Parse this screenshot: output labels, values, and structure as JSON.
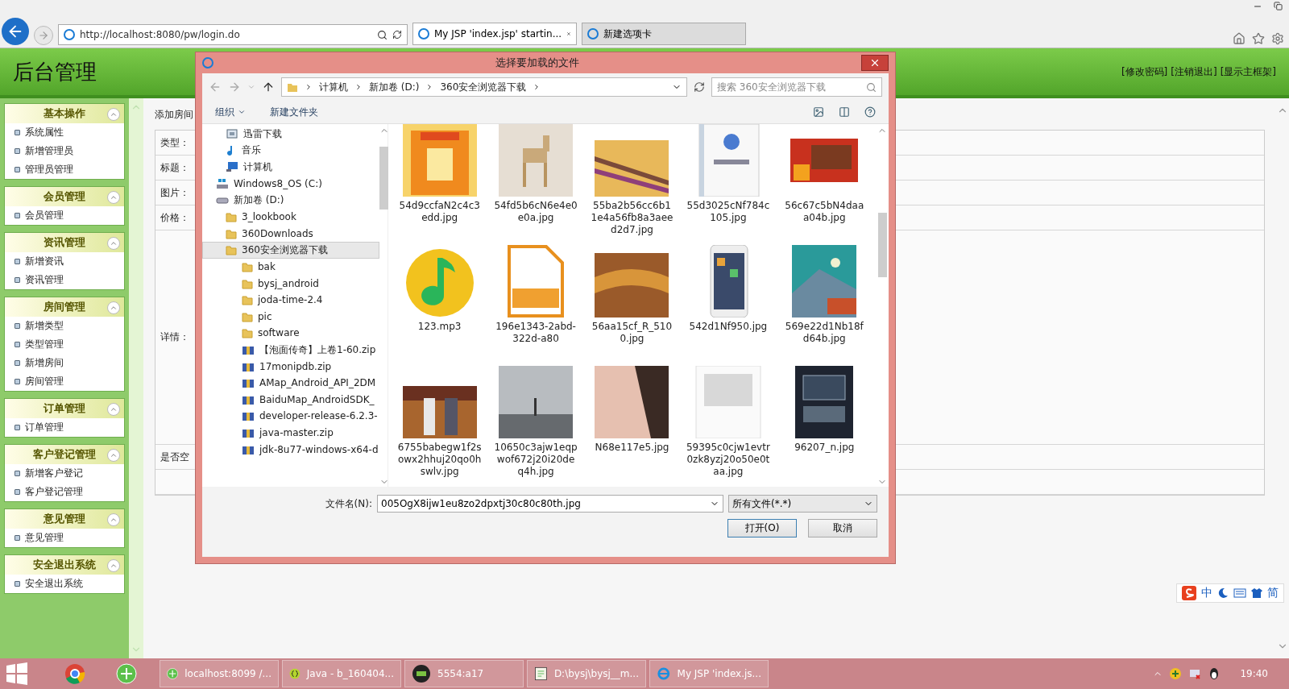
{
  "browser": {
    "address": "http://localhost:8080/pw/login.do",
    "tabs": [
      {
        "label": "My JSP 'index.jsp' startin...",
        "selected": true
      },
      {
        "label": "新建选项卡",
        "selected": false
      }
    ]
  },
  "header": {
    "title": "后台管理",
    "links": [
      "[修改密码]",
      "[注销退出]",
      "[显示主框架]"
    ]
  },
  "sidebar": [
    {
      "title": "基本操作",
      "items": [
        "系统属性",
        "新增管理员",
        "管理员管理"
      ]
    },
    {
      "title": "会员管理",
      "items": [
        "会员管理"
      ]
    },
    {
      "title": "资讯管理",
      "items": [
        "新增资讯",
        "资讯管理"
      ]
    },
    {
      "title": "房间管理",
      "items": [
        "新增类型",
        "类型管理",
        "新增房间",
        "房间管理"
      ]
    },
    {
      "title": "订单管理",
      "items": [
        "订单管理"
      ]
    },
    {
      "title": "客户登记管理",
      "items": [
        "新增客户登记",
        "客户登记管理"
      ]
    },
    {
      "title": "意见管理",
      "items": [
        "意见管理"
      ]
    },
    {
      "title": "安全退出系统",
      "items": [
        "安全退出系统"
      ]
    }
  ],
  "content": {
    "breadcrumb": "添加房间",
    "rows": [
      {
        "label": "类型：",
        "kind": "short"
      },
      {
        "label": "标题：",
        "kind": "short"
      },
      {
        "label": "图片：",
        "kind": "short"
      },
      {
        "label": "价格：",
        "kind": "short"
      },
      {
        "label": "详情：",
        "kind": "tall"
      },
      {
        "label": "是否空",
        "kind": "short"
      },
      {
        "label": "",
        "kind": "short"
      }
    ]
  },
  "dialog": {
    "title": "选择要加载的文件",
    "path": [
      "计算机",
      "新加卷 (D:)",
      "360安全浏览器下载"
    ],
    "search_placeholder": "搜索 360安全浏览器下载",
    "toolbar": [
      "组织",
      "新建文件夹"
    ],
    "tree": [
      {
        "label": "迅雷下载",
        "kind": "download",
        "selected": false
      },
      {
        "label": "音乐",
        "kind": "music",
        "selected": false
      },
      {
        "label": "计算机",
        "kind": "computer",
        "selected": false,
        "children": [
          {
            "label": "Windows8_OS (C:)",
            "kind": "drive",
            "selected": false
          },
          {
            "label": "新加卷 (D:)",
            "kind": "disk",
            "selected": false,
            "children": [
              {
                "label": "3_lookbook",
                "kind": "folder",
                "selected": false
              },
              {
                "label": "360Downloads",
                "kind": "folder",
                "selected": false
              },
              {
                "label": "360安全浏览器下载",
                "kind": "folder",
                "selected": true,
                "children": [
                  {
                    "label": "bak",
                    "kind": "folder",
                    "selected": false
                  },
                  {
                    "label": "bysj_android",
                    "kind": "folder",
                    "selected": false
                  },
                  {
                    "label": "joda-time-2.4",
                    "kind": "folder",
                    "selected": false
                  },
                  {
                    "label": "pic",
                    "kind": "folder",
                    "selected": false
                  },
                  {
                    "label": "software",
                    "kind": "folder",
                    "selected": false
                  },
                  {
                    "label": "【泡面传奇】上卷1-60.zip",
                    "kind": "zip",
                    "selected": false
                  },
                  {
                    "label": "17monipdb.zip",
                    "kind": "zip",
                    "selected": false
                  },
                  {
                    "label": "AMap_Android_API_2DM",
                    "kind": "zip",
                    "selected": false
                  },
                  {
                    "label": "BaiduMap_AndroidSDK_",
                    "kind": "zip",
                    "selected": false
                  },
                  {
                    "label": "developer-release-6.2.3-",
                    "kind": "zip",
                    "selected": false
                  },
                  {
                    "label": "java-master.zip",
                    "kind": "zip",
                    "selected": false
                  },
                  {
                    "label": "jdk-8u77-windows-x64-d",
                    "kind": "zip",
                    "selected": false
                  }
                ]
              }
            ]
          }
        ]
      }
    ],
    "files": [
      {
        "name": "54d9ccfaN2c4c3edd.jpg"
      },
      {
        "name": "54fd5b6cN6e4e0e0a.jpg"
      },
      {
        "name": "55ba2b56cc6b11e4a56fb8a3aeed2d7.jpg"
      },
      {
        "name": "55d3025cNf784c105.jpg"
      },
      {
        "name": "56c67c5bN4daaa04b.jpg"
      },
      {
        "name": "123.mp3",
        "kind": "audio"
      },
      {
        "name": "196e1343-2abd-322d-a80",
        "kind": "pdf"
      },
      {
        "name": "56aa15cf_R_5100.jpg"
      },
      {
        "name": "542d1Nf950.jpg"
      },
      {
        "name": "569e22d1Nb18fd64b.jpg"
      },
      {
        "name": "6755babegw1f2sowx2hhuj20qo0hswlv.jpg"
      },
      {
        "name": "10650c3ajw1eqpwof672j20i20deq4h.jpg"
      },
      {
        "name": "N68e117e5.jpg"
      },
      {
        "name": "59395c0cjw1evtr0zk8yzj20o50e0taa.jpg"
      },
      {
        "name": "96207_n.jpg"
      }
    ],
    "filename_label": "文件名(N):",
    "filename": "005OgX8ijw1eu8zo2dpxtj30c80c80th.jpg",
    "filetype": "所有文件(*.*)",
    "buttons": [
      "打开(O)",
      "取消"
    ]
  },
  "ime": {
    "labels": [
      "中",
      "简"
    ]
  },
  "taskbar": {
    "items": [
      {
        "label": "localhost:8099 /...",
        "kind": "browser"
      },
      {
        "label": "Java - b_160404...",
        "kind": "java"
      },
      {
        "label": "5554:a17",
        "kind": "android"
      },
      {
        "label": "D:\\bysj\\bysj__m...",
        "kind": "editor"
      },
      {
        "label": "My JSP 'index.js...",
        "kind": "ie"
      }
    ],
    "clock": "19:40"
  }
}
